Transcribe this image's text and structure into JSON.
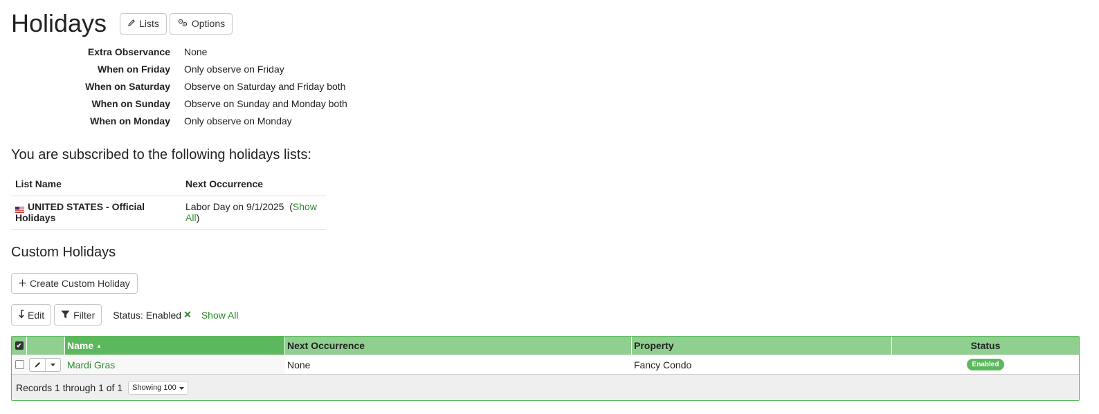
{
  "header": {
    "title": "Holidays",
    "lists_label": "Lists",
    "options_label": "Options"
  },
  "options": [
    {
      "label": "Extra Observance",
      "value": "None"
    },
    {
      "label": "When on Friday",
      "value": "Only observe on Friday"
    },
    {
      "label": "When on Saturday",
      "value": "Observe on Saturday and Friday both"
    },
    {
      "label": "When on Sunday",
      "value": "Observe on Sunday and Monday both"
    },
    {
      "label": "When on Monday",
      "value": "Only observe on Monday"
    }
  ],
  "subscribed": {
    "heading": "You are subscribed to the following holidays lists:",
    "columns": {
      "list_name": "List Name",
      "next": "Next Occurrence"
    },
    "rows": [
      {
        "flag_icon": "us-flag-icon",
        "name": "UNITED STATES - Official Holidays",
        "next": "Labor Day on 9/1/2025",
        "show_all_open": "(",
        "show_all": "Show All",
        "show_all_close": ")"
      }
    ]
  },
  "custom": {
    "heading": "Custom Holidays",
    "create_label": "Create Custom Holiday",
    "edit_label": "Edit",
    "filter_label": "Filter",
    "filter_status": "Status: Enabled",
    "filter_clear": "✕",
    "show_all": "Show All"
  },
  "grid": {
    "columns": {
      "name": "Name",
      "next": "Next Occurrence",
      "property": "Property",
      "status": "Status"
    },
    "sort_indicator": "▲",
    "rows": [
      {
        "name": "Mardi Gras",
        "next": "None",
        "property": "Fancy Condo",
        "status": "Enabled"
      }
    ],
    "footer": {
      "records": "Records 1 through 1 of 1",
      "showing": "Showing 100"
    }
  },
  "colors": {
    "accent": "#5cb85c",
    "accent_light": "#8fcf8f",
    "link": "#2e8b2e"
  }
}
